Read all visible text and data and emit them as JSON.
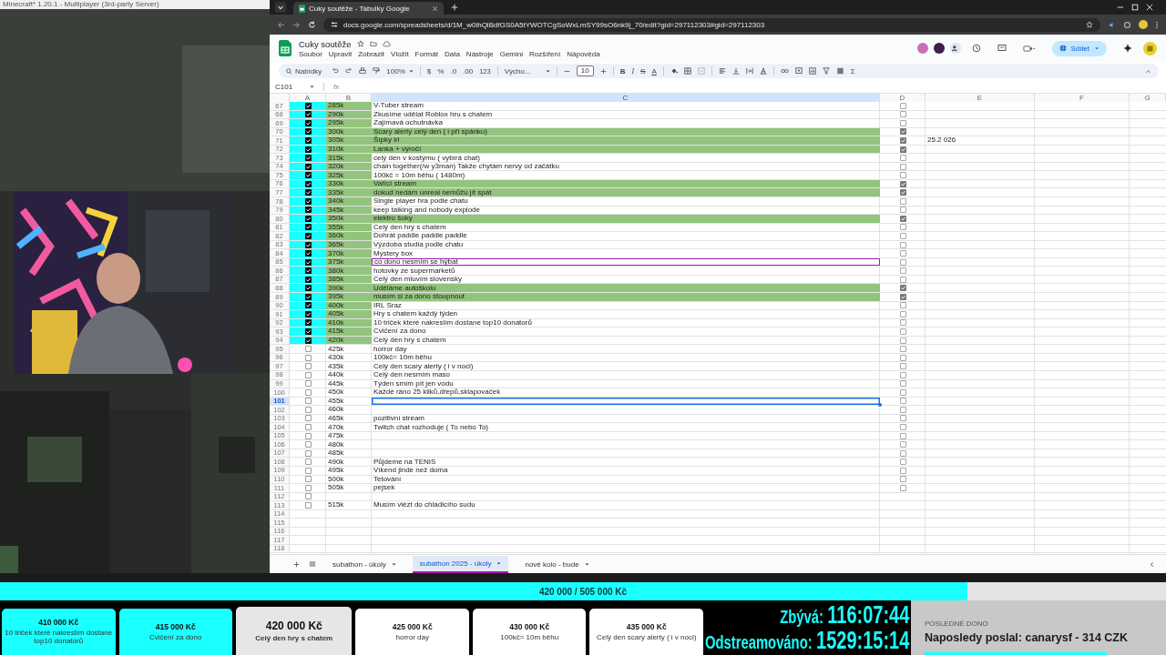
{
  "game_window": {
    "title": "Minecraft* 1.20.1 - Multiplayer (3rd-party Server)"
  },
  "browser": {
    "tab_title": "Cuky soutěže - Tabulky Google",
    "url": "docs.google.com/spreadsheets/d/1M_w0ihQlBdfGS0A5tYWOTCgSoWxLmSY99sO6nk9j_70/edit?gid=297112303#gid=297112303"
  },
  "sheet": {
    "title": "Cuky soutěže",
    "menu": [
      "Soubor",
      "Upravit",
      "Zobrazit",
      "Vložit",
      "Formát",
      "Data",
      "Nástroje",
      "Gemini",
      "Rozšíření",
      "Nápověda"
    ],
    "share": "Sdílet"
  },
  "toolbar": {
    "search": "Nabídky",
    "zoom": "100%",
    "currency": "$",
    "percent": "%",
    "dec_less": ".0",
    "dec_more": ".00",
    "number_format": "123",
    "font": "Výcho...",
    "font_size": "10",
    "bold": "B",
    "italic": "I",
    "strike": "S",
    "text_color": "A",
    "functions": "Σ"
  },
  "formula_bar": {
    "cell": "C101",
    "fx": "fx"
  },
  "columns": [
    {
      "label": "A",
      "selected": false
    },
    {
      "label": "B",
      "selected": false
    },
    {
      "label": "C",
      "selected": true
    },
    {
      "label": "D",
      "selected": false
    },
    {
      "label": "E",
      "selected": false
    },
    {
      "label": "F",
      "selected": false
    },
    {
      "label": "G",
      "selected": false
    }
  ],
  "rows": [
    {
      "n": "67",
      "a_checked": true,
      "b": "285k",
      "c": "V-Tuber stream",
      "d_checked": false,
      "selected": false,
      "peer_cursor": false
    },
    {
      "n": "68",
      "a_checked": true,
      "b": "290k",
      "c": "Zkusíme udělat Roblox hru s chatem",
      "d_checked": false,
      "selected": false,
      "peer_cursor": false
    },
    {
      "n": "69",
      "a_checked": true,
      "b": "295k",
      "c": "Zajímavá ochutnávka",
      "d_checked": false,
      "selected": false,
      "peer_cursor": false
    },
    {
      "n": "70",
      "a_checked": true,
      "b": "300k",
      "c": "Scary alerty celý den ( i při spánku)",
      "d_checked": true,
      "selected": false,
      "peer_cursor": false
    },
    {
      "n": "71",
      "a_checked": true,
      "b": "305k",
      "c": "Šípky irl",
      "d_checked": true,
      "e": "25.2 026",
      "selected": false,
      "peer_cursor": false
    },
    {
      "n": "72",
      "a_checked": true,
      "b": "310k",
      "c": "Lanka + výročí",
      "d_checked": true,
      "selected": false,
      "peer_cursor": false
    },
    {
      "n": "73",
      "a_checked": true,
      "b": "315k",
      "c": "celý den v kostýmu ( vybírá chat)",
      "d_checked": false,
      "selected": false,
      "peer_cursor": false
    },
    {
      "n": "74",
      "a_checked": true,
      "b": "320k",
      "c": "chain together(/w y3man) Takže chytám nervy od začátku",
      "d_checked": false,
      "selected": false,
      "peer_cursor": false
    },
    {
      "n": "75",
      "a_checked": true,
      "b": "325k",
      "c": "100kč = 10m běhu ( 1480m)",
      "d_checked": false,
      "selected": false,
      "peer_cursor": false
    },
    {
      "n": "76",
      "a_checked": true,
      "b": "330k",
      "c": "Vařící stream",
      "d_checked": true,
      "selected": false,
      "peer_cursor": false
    },
    {
      "n": "77",
      "a_checked": true,
      "b": "335k",
      "c": "dokud nedám unreal nemůžu jít spát",
      "d_checked": true,
      "selected": false,
      "peer_cursor": false
    },
    {
      "n": "78",
      "a_checked": true,
      "b": "340k",
      "c": "Single player hra podle chatu",
      "d_checked": false,
      "selected": false,
      "peer_cursor": false
    },
    {
      "n": "79",
      "a_checked": true,
      "b": "345k",
      "c": "keep talking and nobody explode",
      "d_checked": false,
      "selected": false,
      "peer_cursor": false
    },
    {
      "n": "80",
      "a_checked": true,
      "b": "350k",
      "c": "elektro šoky",
      "d_checked": true,
      "selected": false,
      "peer_cursor": false
    },
    {
      "n": "81",
      "a_checked": true,
      "b": "355k",
      "c": "Celý den hry s chatem",
      "d_checked": false,
      "selected": false,
      "peer_cursor": false
    },
    {
      "n": "82",
      "a_checked": true,
      "b": "360k",
      "c": "Dohrát paddle paddle paddle",
      "d_checked": false,
      "selected": false,
      "peer_cursor": false
    },
    {
      "n": "83",
      "a_checked": true,
      "b": "365k",
      "c": "Výzdoba studia podle chatu",
      "d_checked": false,
      "selected": false,
      "peer_cursor": false
    },
    {
      "n": "84",
      "a_checked": true,
      "b": "370k",
      "c": "Mystery box",
      "d_checked": false,
      "selected": false,
      "peer_cursor": false
    },
    {
      "n": "85",
      "a_checked": true,
      "b": "375k",
      "c": "co dono nesmím se hýbat",
      "d_checked": false,
      "selected": false,
      "peer_cursor": true
    },
    {
      "n": "86",
      "a_checked": true,
      "b": "380k",
      "c": "hotovky ze supermarketů",
      "d_checked": false,
      "selected": false,
      "peer_cursor": false
    },
    {
      "n": "87",
      "a_checked": true,
      "b": "385k",
      "c": "Celý den mluvím slovensky",
      "d_checked": false,
      "selected": false,
      "peer_cursor": false
    },
    {
      "n": "88",
      "a_checked": true,
      "b": "390k",
      "c": "Uděláme autoškolu",
      "d_checked": true,
      "selected": false,
      "peer_cursor": false
    },
    {
      "n": "89",
      "a_checked": true,
      "b": "395k",
      "c": "musím si za dono stoupnout",
      "d_checked": true,
      "selected": false,
      "peer_cursor": false
    },
    {
      "n": "90",
      "a_checked": true,
      "b": "400k",
      "c": "IRL Sraz",
      "d_checked": false,
      "selected": false,
      "peer_cursor": false
    },
    {
      "n": "91",
      "a_checked": true,
      "b": "405k",
      "c": "Hry s chatem každý týden",
      "d_checked": false,
      "selected": false,
      "peer_cursor": false
    },
    {
      "n": "92",
      "a_checked": true,
      "b": "410k",
      "c": "10 triček které nakreslím dostane top10 donatorů",
      "d_checked": false,
      "selected": false,
      "peer_cursor": false
    },
    {
      "n": "93",
      "a_checked": true,
      "b": "415k",
      "c": "Cvičení za dono",
      "d_checked": false,
      "selected": false,
      "peer_cursor": false
    },
    {
      "n": "94",
      "a_checked": true,
      "b": "420k",
      "c": "Celý den hry s chatem",
      "d_checked": false,
      "selected": false,
      "peer_cursor": false
    },
    {
      "n": "95",
      "a_checked": false,
      "b": "425k",
      "c": "horror day",
      "d_checked": false,
      "selected": false,
      "peer_cursor": false
    },
    {
      "n": "96",
      "a_checked": false,
      "b": "430k",
      "c": "100kč= 10m běhu",
      "d_checked": false,
      "selected": false,
      "peer_cursor": false
    },
    {
      "n": "97",
      "a_checked": false,
      "b": "435k",
      "c": "Celý den scary alerty ( i v noci)",
      "d_checked": false,
      "selected": false,
      "peer_cursor": false
    },
    {
      "n": "98",
      "a_checked": false,
      "b": "440k",
      "c": "Celý den nesmím maso",
      "d_checked": false,
      "selected": false,
      "peer_cursor": false
    },
    {
      "n": "99",
      "a_checked": false,
      "b": "445k",
      "c": "Týden smím pít jen vodu",
      "d_checked": false,
      "selected": false,
      "peer_cursor": false
    },
    {
      "n": "100",
      "a_checked": false,
      "b": "450k",
      "c": "Každé ráno 25 kliků,dřepů,sklapovaček",
      "d_checked": false,
      "selected": false,
      "peer_cursor": false
    },
    {
      "n": "101",
      "a_checked": false,
      "b": "455k",
      "d_checked": false,
      "selected": true,
      "peer_cursor": false
    },
    {
      "n": "102",
      "a_checked": false,
      "b": "460k",
      "d_checked": false,
      "selected": false,
      "peer_cursor": false
    },
    {
      "n": "103",
      "a_checked": false,
      "b": "465k",
      "c": "pozitivní stream",
      "d_checked": false,
      "selected": false,
      "peer_cursor": false
    },
    {
      "n": "104",
      "a_checked": false,
      "b": "470k",
      "c": "Twitch chat rozhoduje ( To nebo To)",
      "d_checked": false,
      "selected": false,
      "peer_cursor": false
    },
    {
      "n": "105",
      "a_checked": false,
      "b": "475k",
      "d_checked": false,
      "selected": false,
      "peer_cursor": false
    },
    {
      "n": "106",
      "a_checked": false,
      "b": "480k",
      "d_checked": false,
      "selected": false,
      "peer_cursor": false
    },
    {
      "n": "107",
      "a_checked": false,
      "b": "485k",
      "d_checked": false,
      "selected": false,
      "peer_cursor": false
    },
    {
      "n": "108",
      "a_checked": false,
      "b": "490k",
      "c": "Půjdeme na TENIS",
      "d_checked": false,
      "selected": false,
      "peer_cursor": false
    },
    {
      "n": "109",
      "a_checked": false,
      "b": "495k",
      "c": "Víkend jinde než doma",
      "d_checked": false,
      "selected": false,
      "peer_cursor": false
    },
    {
      "n": "110",
      "a_checked": false,
      "b": "500k",
      "c": "Tetování",
      "d_checked": false,
      "selected": false,
      "peer_cursor": false
    },
    {
      "n": "111",
      "a_checked": false,
      "b": "505k",
      "c": "pejsek",
      "d_checked": false,
      "selected": false,
      "peer_cursor": false
    },
    {
      "n": "112",
      "a_checked": false,
      "selected": false,
      "peer_cursor": false
    },
    {
      "n": "113",
      "a_checked": false,
      "b": "515k",
      "c": "Musím vlézt do chladicího sudu",
      "selected": false,
      "peer_cursor": false
    },
    {
      "n": "114",
      "selected": false,
      "peer_cursor": false
    },
    {
      "n": "115",
      "selected": false,
      "peer_cursor": false
    },
    {
      "n": "116",
      "selected": false,
      "peer_cursor": false
    },
    {
      "n": "117",
      "selected": false,
      "peer_cursor": false
    },
    {
      "n": "118",
      "selected": false,
      "peer_cursor": false
    }
  ],
  "sheet_tabs": [
    {
      "label": "subathon - úkoly",
      "selected": false
    },
    {
      "label": "subathon 2025 - úkoly",
      "selected": true
    },
    {
      "label": "nové kolo - bude",
      "selected": false
    }
  ],
  "goal_bar": {
    "label": "420 000 / 505 000 Kč",
    "level": 0.83
  },
  "goal_cards": [
    {
      "amount": "410 000 Kč",
      "task": "10 triček které nakreslím dostane top10 donatorů",
      "kind": "done"
    },
    {
      "amount": "415 000 Kč",
      "task": "Cvičení za dono",
      "kind": "done"
    },
    {
      "amount": "420 000 Kč",
      "task": "Celý den hry s chatem",
      "kind": "current"
    },
    {
      "amount": "425 000 Kč",
      "task": "horror day",
      "kind": "upcoming"
    },
    {
      "amount": "430 000 Kč",
      "task": "100kč= 10m běhu",
      "kind": "upcoming"
    },
    {
      "amount": "435 000 Kč",
      "task": "Celý den scary alerty ( i v noci)",
      "kind": "upcoming"
    }
  ],
  "timers": [
    {
      "label": "Zbývá:",
      "value": "116:07:44"
    },
    {
      "label": "Odstreamováno:",
      "value": "1529:15:14"
    }
  ],
  "last_donation": {
    "heading": "POSLEDNÉ DONO",
    "text": "Naposledy poslal: canarysf - 314 CZK"
  }
}
